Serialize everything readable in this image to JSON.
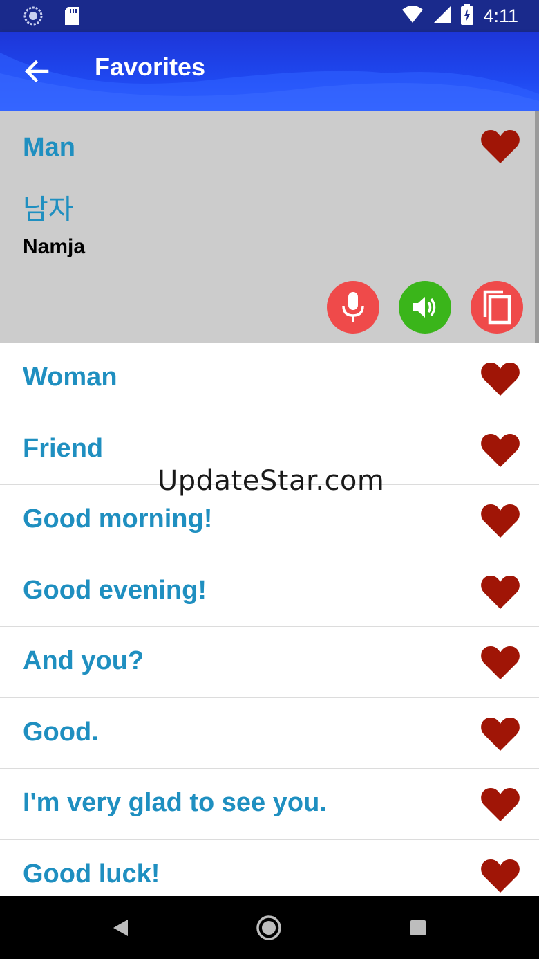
{
  "status_bar": {
    "time": "4:11"
  },
  "app_bar": {
    "title": "Favorites"
  },
  "expanded_item": {
    "phrase": "Man",
    "translation": "남자",
    "romanization": "Namja"
  },
  "list_items": [
    {
      "phrase": "Woman"
    },
    {
      "phrase": "Friend"
    },
    {
      "phrase": "Good morning!"
    },
    {
      "phrase": "Good evening!"
    },
    {
      "phrase": "And you?"
    },
    {
      "phrase": "Good."
    },
    {
      "phrase": "I'm very glad to see you."
    },
    {
      "phrase": "Good luck!"
    }
  ],
  "watermark": "UpdateStar.com",
  "colors": {
    "phrase_text": "#1f8fc0",
    "heart": "#a01506",
    "mic_button": "#ef4a4a",
    "speaker_button": "#3ab51a",
    "copy_button": "#ef4a4a",
    "app_bar": "#1f48f0"
  },
  "icons": {
    "back": "arrow-left-icon",
    "favorite": "heart-icon",
    "mic": "microphone-icon",
    "speaker": "speaker-icon",
    "copy": "copy-icon"
  }
}
